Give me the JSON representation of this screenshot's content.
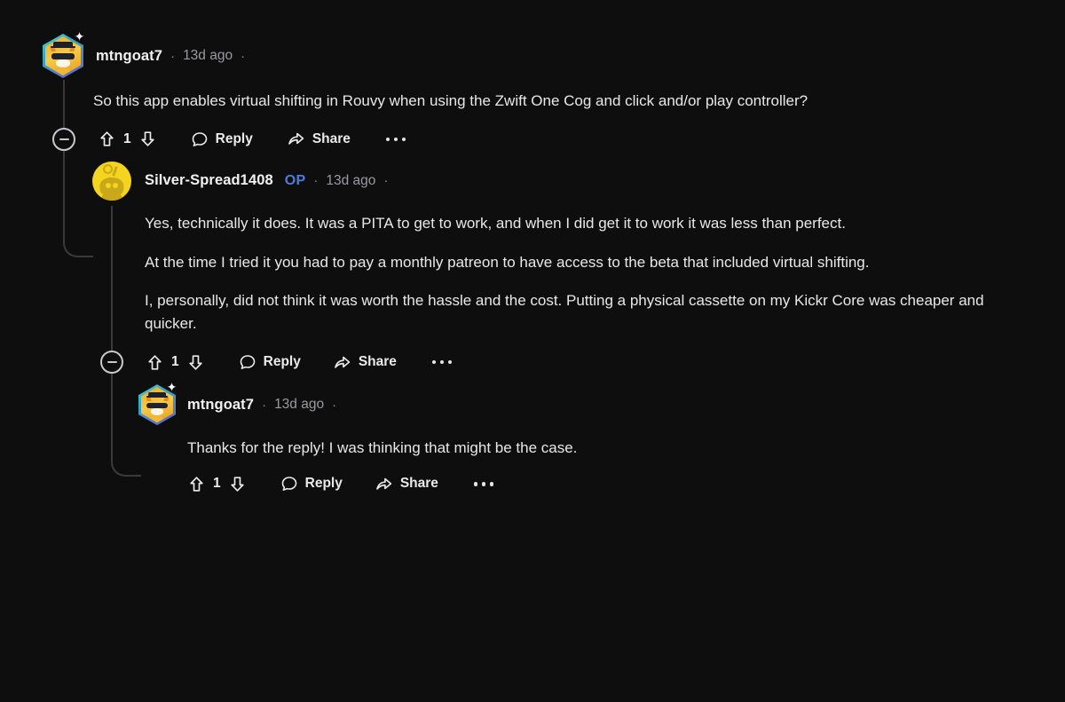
{
  "theme": {
    "background": "#0e0e0f",
    "text_primary": "#e8e8e8",
    "text_muted": "#9b9b9e",
    "op_blue": "#4a7ddb",
    "threadline": "#3a3a3c",
    "avatar_yellow": "#f5d41f"
  },
  "labels": {
    "reply": "Reply",
    "share": "Share",
    "more": "more-options",
    "collapse": "collapse-thread",
    "upvote": "upvote",
    "downvote": "downvote",
    "separator": "·"
  },
  "comments": [
    {
      "id": "c1",
      "depth": 0,
      "author": "mtngoat7",
      "is_op": false,
      "op_label": "",
      "timestamp": "13d ago",
      "avatar_type": "hex-cat",
      "has_collapse": true,
      "votes": "1",
      "paragraphs": [
        "So this app enables virtual shifting in Rouvy when using the Zwift One Cog and click and/or play controller?"
      ]
    },
    {
      "id": "c2",
      "depth": 1,
      "author": "Silver-Spread1408",
      "is_op": true,
      "op_label": "OP",
      "timestamp": "13d ago",
      "avatar_type": "circle-snoo",
      "has_collapse": true,
      "votes": "1",
      "paragraphs": [
        "Yes, technically it does. It was a PITA to get to work, and when I did get it to work it was less than perfect.",
        "At the time I tried it you had to pay a monthly patreon to have access to the beta that included virtual shifting.",
        "I, personally, did not think it was worth the hassle and the cost. Putting a physical cassette on my Kickr Core was cheaper and quicker."
      ]
    },
    {
      "id": "c3",
      "depth": 2,
      "author": "mtngoat7",
      "is_op": false,
      "op_label": "",
      "timestamp": "13d ago",
      "avatar_type": "hex-cat",
      "has_collapse": false,
      "votes": "1",
      "paragraphs": [
        "Thanks for the reply! I was thinking that might be the case."
      ]
    }
  ]
}
